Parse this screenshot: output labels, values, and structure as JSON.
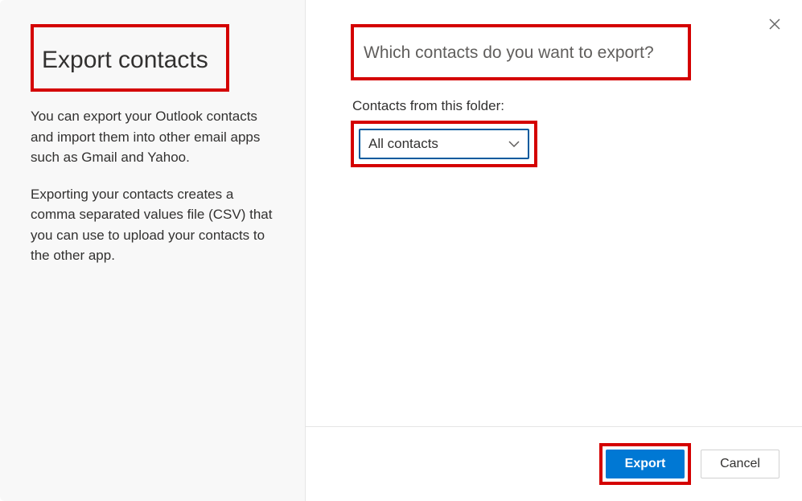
{
  "left": {
    "title": "Export contacts",
    "desc1": "You can export your Outlook contacts and import them into other email apps such as Gmail and Yahoo.",
    "desc2": "Exporting your contacts creates a comma separated values file (CSV) that you can use to upload your contacts to the other app."
  },
  "right": {
    "question": "Which contacts do you want to export?",
    "folder_label": "Contacts from this folder:",
    "selected": "All contacts"
  },
  "footer": {
    "export": "Export",
    "cancel": "Cancel"
  }
}
